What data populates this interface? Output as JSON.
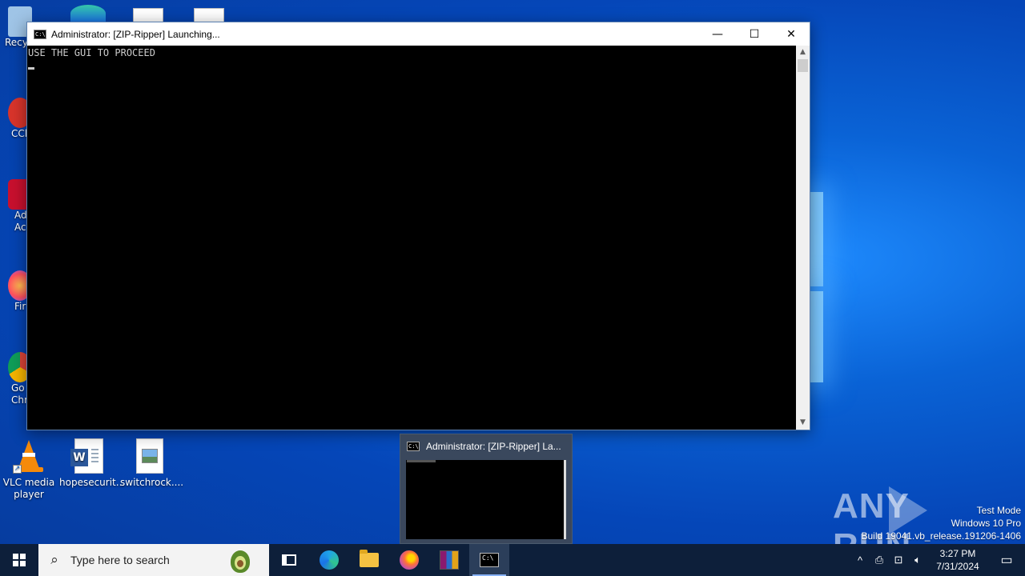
{
  "desktop": {
    "partial_icons": [
      {
        "label": "Recy"
      },
      {
        "label": "CCl"
      },
      {
        "label": "Ad\nAcr"
      },
      {
        "label": "Fir"
      },
      {
        "label": "Go\nChr"
      }
    ],
    "icons": [
      {
        "label": "VLC media player"
      },
      {
        "label": "hopesecurit..."
      },
      {
        "label": "switchrock...."
      }
    ]
  },
  "cmd_window": {
    "title": "Administrator:  [ZIP-Ripper] Launching...",
    "icon_text": "C:\\",
    "console_text": "USE THE GUI TO PROCEED",
    "controls": {
      "minimize": "—",
      "maximize": "☐",
      "close": "✕"
    }
  },
  "taskbar_preview": {
    "title": "Administrator:  [ZIP-Ripper] La..."
  },
  "watermark": {
    "text": "ANY RUN",
    "test_mode": "Test Mode",
    "edition": "Windows 10 Pro",
    "build": "Build 19041.vb_release.191206-1406"
  },
  "taskbar": {
    "search_placeholder": "Type here to search",
    "clock_time": "3:27 PM",
    "clock_date": "7/31/2024"
  }
}
